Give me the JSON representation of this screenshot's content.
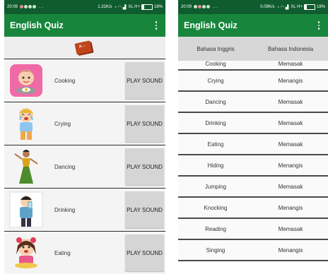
{
  "left": {
    "statusbar": {
      "time": "20:09",
      "speed": "1.31K/s",
      "network": "XL H+",
      "battery": "18%"
    },
    "title": "English Quiz",
    "logo_text": "A→",
    "rows": [
      {
        "word": "Cooking",
        "button": "PLAY SOUND",
        "icon": "cooking-girl-icon"
      },
      {
        "word": "Crying",
        "button": "PLAY SOUND",
        "icon": "crying-boy-icon"
      },
      {
        "word": "Dancing",
        "button": "PLAY SOUND",
        "icon": "dancing-woman-icon"
      },
      {
        "word": "Drinking",
        "button": "PLAY SOUND",
        "icon": "drinking-boy-icon"
      },
      {
        "word": "Eating",
        "button": "PLAY SOUND",
        "icon": "eating-girl-icon"
      }
    ]
  },
  "right": {
    "statusbar": {
      "time": "20:09",
      "speed": "0.09K/s",
      "network": "XL H+",
      "battery": "18%"
    },
    "title": "English Quiz",
    "table": {
      "headers": [
        "Bahasa Inggris",
        "Bahasa Indonesia"
      ],
      "rows": [
        [
          "Cooking",
          "Memasak"
        ],
        [
          "Crying",
          "Menangis"
        ],
        [
          "Dancing",
          "Memasak"
        ],
        [
          "Drinking",
          "Memasak"
        ],
        [
          "Eating",
          "Memasak"
        ],
        [
          "Hiding",
          "Menangis"
        ],
        [
          "Jumping",
          "Memasak"
        ],
        [
          "Knocking",
          "Menangis"
        ],
        [
          "Reading",
          "Memasak"
        ],
        [
          "Singing",
          "Menangis"
        ]
      ]
    }
  },
  "colors": {
    "statusbar": "#0f5c2e",
    "appbar": "#17863c",
    "button": "#d5d5d5",
    "header": "#d7d7d7"
  }
}
